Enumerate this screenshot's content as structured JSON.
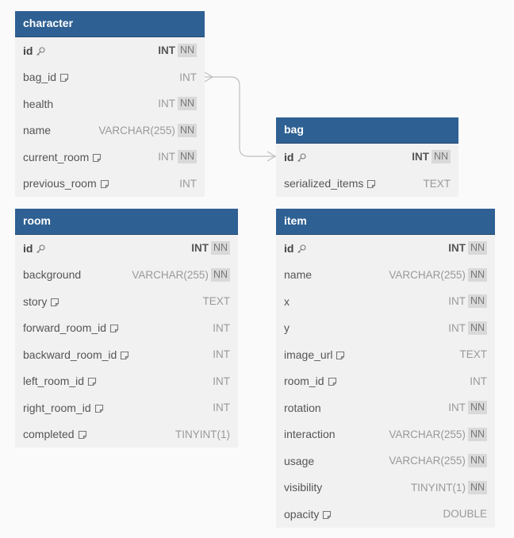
{
  "icons": {
    "key": "key-icon",
    "note": "note-icon"
  },
  "colors": {
    "header": "#2e6093",
    "body": "#f1f1f1",
    "badge": "#d9d9d9",
    "relation": "#bfbfbf"
  },
  "tables": [
    {
      "name": "character",
      "fields": [
        {
          "name": "id",
          "type": "INT",
          "nn": "NN",
          "pk": true
        },
        {
          "name": "bag_id",
          "type": "INT",
          "note": true
        },
        {
          "name": "health",
          "type": "INT",
          "nn": "NN"
        },
        {
          "name": "name",
          "type": "VARCHAR(255)",
          "nn": "NN"
        },
        {
          "name": "current_room",
          "type": "INT",
          "nn": "NN",
          "note": true
        },
        {
          "name": "previous_room",
          "type": "INT",
          "note": true
        }
      ]
    },
    {
      "name": "bag",
      "fields": [
        {
          "name": "id",
          "type": "INT",
          "nn": "NN",
          "pk": true
        },
        {
          "name": "serialized_items",
          "type": "TEXT",
          "note": true
        }
      ]
    },
    {
      "name": "room",
      "fields": [
        {
          "name": "id",
          "type": "INT",
          "nn": "NN",
          "pk": true
        },
        {
          "name": "background",
          "type": "VARCHAR(255)",
          "nn": "NN"
        },
        {
          "name": "story",
          "type": "TEXT",
          "note": true
        },
        {
          "name": "forward_room_id",
          "type": "INT",
          "note": true
        },
        {
          "name": "backward_room_id",
          "type": "INT",
          "note": true
        },
        {
          "name": "left_room_id",
          "type": "INT",
          "note": true
        },
        {
          "name": "right_room_id",
          "type": "INT",
          "note": true
        },
        {
          "name": "completed",
          "type": "TINYINT(1)",
          "note": true
        }
      ]
    },
    {
      "name": "item",
      "fields": [
        {
          "name": "id",
          "type": "INT",
          "nn": "NN",
          "pk": true
        },
        {
          "name": "name",
          "type": "VARCHAR(255)",
          "nn": "NN"
        },
        {
          "name": "x",
          "type": "INT",
          "nn": "NN"
        },
        {
          "name": "y",
          "type": "INT",
          "nn": "NN"
        },
        {
          "name": "image_url",
          "type": "TEXT",
          "note": true
        },
        {
          "name": "room_id",
          "type": "INT",
          "note": true
        },
        {
          "name": "rotation",
          "type": "INT",
          "nn": "NN"
        },
        {
          "name": "interaction",
          "type": "VARCHAR(255)",
          "nn": "NN"
        },
        {
          "name": "usage",
          "type": "VARCHAR(255)",
          "nn": "NN"
        },
        {
          "name": "visibility",
          "type": "TINYINT(1)",
          "nn": "NN"
        },
        {
          "name": "opacity",
          "type": "DOUBLE",
          "note": true
        }
      ]
    }
  ],
  "relations": [
    {
      "from": "character.bag_id",
      "to": "bag.id"
    }
  ]
}
